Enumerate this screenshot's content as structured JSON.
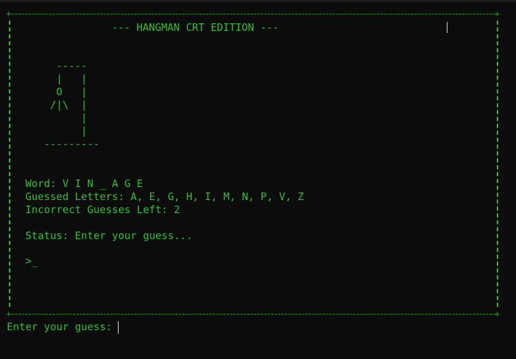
{
  "terminal": {
    "title": "--- HANGMAN CRT EDITION ---",
    "hangman_art": "  -----\n  |   |\n  O   |\n /|\\  |\n      |\n      |\n---------",
    "word_line": "Word: V I N _ A G E",
    "guessed_line": "Guessed Letters: A, E, G, H, I, M, N, P, V, Z",
    "incorrect_line": "Incorrect Guesses Left: 2",
    "status_line": "Status: Enter your guess...",
    "prompt_line": ">_"
  },
  "input": {
    "label": "Enter your guess:",
    "value": ""
  },
  "colors": {
    "background": "#0c0c0c",
    "text": "#2fc02f",
    "border": "#2a9a2a"
  }
}
